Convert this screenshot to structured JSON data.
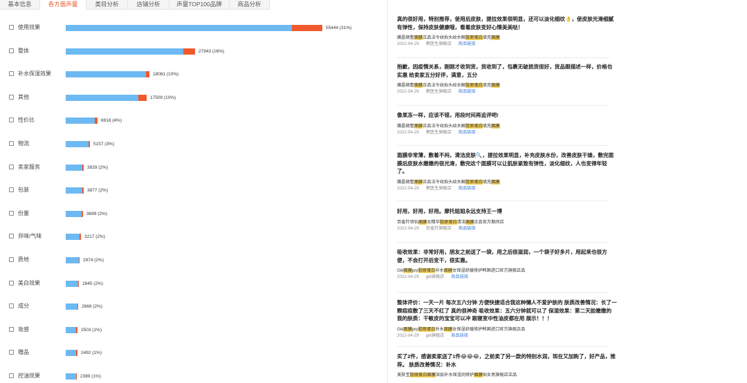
{
  "tabs": [
    "基本信息",
    "各方面声量",
    "类目分析",
    "店铺分析",
    "声量TOP100品牌",
    "商品分析"
  ],
  "active_tab": 1,
  "bars": [
    {
      "label": "使用效果",
      "value_text": "55444 (31%)"
    },
    {
      "label": "整体",
      "value_text": "27943 (16%)"
    },
    {
      "label": "补水保湿效果",
      "value_text": "18081 (10%)"
    },
    {
      "label": "其他",
      "value_text": "17509 (10%)"
    },
    {
      "label": "性价比",
      "value_text": "6918 (4%)"
    },
    {
      "label": "物流",
      "value_text": "5157 (3%)"
    },
    {
      "label": "卖家服务",
      "value_text": "3929 (2%)"
    },
    {
      "label": "包装",
      "value_text": "3877 (2%)"
    },
    {
      "label": "份量",
      "value_text": "3699 (2%)"
    },
    {
      "label": "异味/气味",
      "value_text": "3217 (2%)"
    },
    {
      "label": "质地",
      "value_text": "2974 (2%)"
    },
    {
      "label": "美白效果",
      "value_text": "2845 (2%)"
    },
    {
      "label": "成分",
      "value_text": "2668 (2%)"
    },
    {
      "label": "妆感",
      "value_text": "2503 (1%)"
    },
    {
      "label": "赠品",
      "value_text": "2492 (1%)"
    },
    {
      "label": "控油效果",
      "value_text": "2389 (1%)"
    }
  ],
  "bar_values": [
    55444,
    27943,
    18081,
    17509,
    6918,
    5157,
    3929,
    3877,
    3699,
    3217,
    2974,
    2845,
    2668,
    2503,
    2492,
    2389
  ],
  "colors": {
    "accent": "#e8562a",
    "bar_main": "#6db9f2",
    "bar_secondary": "#f0592c",
    "highlight": "#f7d45c",
    "link": "#3b7cd6"
  },
  "reviews": [
    {
      "text": "真的很好用，特别推荐，使用后皮肤，提拉效果很明显，还可以淡化细纹👌，使皮肤光滑细腻有弹性，保持皮肤健康哦，看着皮肤变好心情美美哒！",
      "product": [
        {
          "t": "魔晶微整",
          "h": false
        },
        {
          "t": "面膜",
          "h": true
        },
        {
          "t": "正品法令纹抬头纹水解",
          "h": false
        },
        {
          "t": "胶原蛋白",
          "h": true
        },
        {
          "t": "填充",
          "h": false
        },
        {
          "t": "面膜",
          "h": true
        }
      ],
      "date": "2022-04-29",
      "shop": "蔡医生旗舰店",
      "link": "商品链接"
    },
    {
      "text": "抱歉，因疫情关系，刚刚才收到货，货收到了，包裹无破损货很好，货品跟描述一样，价格也实惠 给卖家五分好评，满意，五分",
      "product": [
        {
          "t": "魔晶微整",
          "h": false
        },
        {
          "t": "面膜",
          "h": true
        },
        {
          "t": "正品法令纹抬头纹水解",
          "h": false
        },
        {
          "t": "胶原蛋白",
          "h": true
        },
        {
          "t": "填充",
          "h": false
        },
        {
          "t": "面膜",
          "h": true
        }
      ],
      "date": "2022-04-29",
      "shop": "蔡医生旗舰店",
      "link": "商品链接"
    },
    {
      "text": "像果冻一样，应该不错，用段时间再追评吧!",
      "product": [
        {
          "t": "魔晶微整",
          "h": false
        },
        {
          "t": "面膜",
          "h": true
        },
        {
          "t": "正品法令纹抬头纹水解",
          "h": false
        },
        {
          "t": "胶原蛋白",
          "h": true
        },
        {
          "t": "填充",
          "h": false
        },
        {
          "t": "面膜",
          "h": true
        }
      ],
      "date": "2022-04-29",
      "shop": "蔡医生旗舰店",
      "link": "商品链接"
    },
    {
      "text": "面膜非常薄，敷着不闷，清洁皮肤🔍，提拉效果明显，补充皮肤水份，改善皮肤干燥，敷完面膜后皮肤水嫩嫩的很光滑，敷完这个面膜可以让肌肤紧致有弹性，淡化细纹，人也变得年轻了。",
      "product": [
        {
          "t": "魔晶微整",
          "h": false
        },
        {
          "t": "面膜",
          "h": true
        },
        {
          "t": "正品法令纹抬头纹水解",
          "h": false
        },
        {
          "t": "胶原蛋白",
          "h": true
        },
        {
          "t": "填充",
          "h": false
        },
        {
          "t": "面膜",
          "h": true
        }
      ],
      "date": "2022-04-29",
      "shop": "蔡医生旗舰店",
      "link": "商品链接"
    },
    {
      "text": "好用，好用，好用。摩托姐姐永远支持王一博",
      "product": [
        {
          "t": "百雀羚领钻",
          "h": false
        },
        {
          "t": "面膜",
          "h": true
        },
        {
          "t": "女精华",
          "h": false
        },
        {
          "t": "胶原蛋白",
          "h": true
        },
        {
          "t": "清洁",
          "h": false
        },
        {
          "t": "面膜",
          "h": true
        },
        {
          "t": "正品官方期间店",
          "h": false
        }
      ],
      "date": "2022-04-29",
      "shop": "百雀羚旗舰店",
      "link": "商品链接"
    },
    {
      "text": "吸收效果：非常好用，朋友之前送了一袋，用之后很滋润，一个袋子好多片，用起来也很方便，不会打开后变干，很实惠。",
      "product": [
        {
          "t": "Gik",
          "h": false
        },
        {
          "t": "面膜",
          "h": true
        },
        {
          "t": "prp",
          "h": false
        },
        {
          "t": "胶原蛋白",
          "h": true
        },
        {
          "t": "补水",
          "h": false
        },
        {
          "t": "面膜",
          "h": true
        },
        {
          "t": "女保湿舒缓修护韩国进口官方旗舰正品",
          "h": false
        }
      ],
      "date": "2022-04-29",
      "shop": "gik旗舰店",
      "link": "商品链接"
    },
    {
      "text": "整体评价：一天一片 每次五六分钟 方便快捷适合我这种懒人不爱护肤的 肤质改善情况：长了一颗痘痘敷了三天不红了 真的很神奇 吸收效果：五六分钟就可以了 保湿效果：第二天脸嫩嫩的 我的肤质：干敏皮的宝宝可以冲 跟寝室中性油皮都在用 展示！！！",
      "product": [
        {
          "t": "Gik",
          "h": false
        },
        {
          "t": "面膜",
          "h": true
        },
        {
          "t": "prp",
          "h": false
        },
        {
          "t": "胶原蛋白",
          "h": true
        },
        {
          "t": "补水",
          "h": false
        },
        {
          "t": "面膜",
          "h": true
        },
        {
          "t": "女保湿舒缓修护韩国进口官方旗舰正品",
          "h": false
        }
      ],
      "date": "2022-04-29",
      "shop": "gik旗舰店",
      "link": "商品链接"
    },
    {
      "text": "买了2件，感谢卖家送了1件😂😂😂，之前卖了另一款的特别水润，现在又加购了，好产品，推荐。 肤质改善情况：补水",
      "product": [
        {
          "t": "美肤宝",
          "h": false
        },
        {
          "t": "胶原蛋白面膜",
          "h": true
        },
        {
          "t": "深层补水保湿润修护",
          "h": false
        },
        {
          "t": "面膜",
          "h": true
        },
        {
          "t": "贴女男旗舰店正品",
          "h": false
        }
      ],
      "date": "",
      "shop": "",
      "link": ""
    }
  ]
}
